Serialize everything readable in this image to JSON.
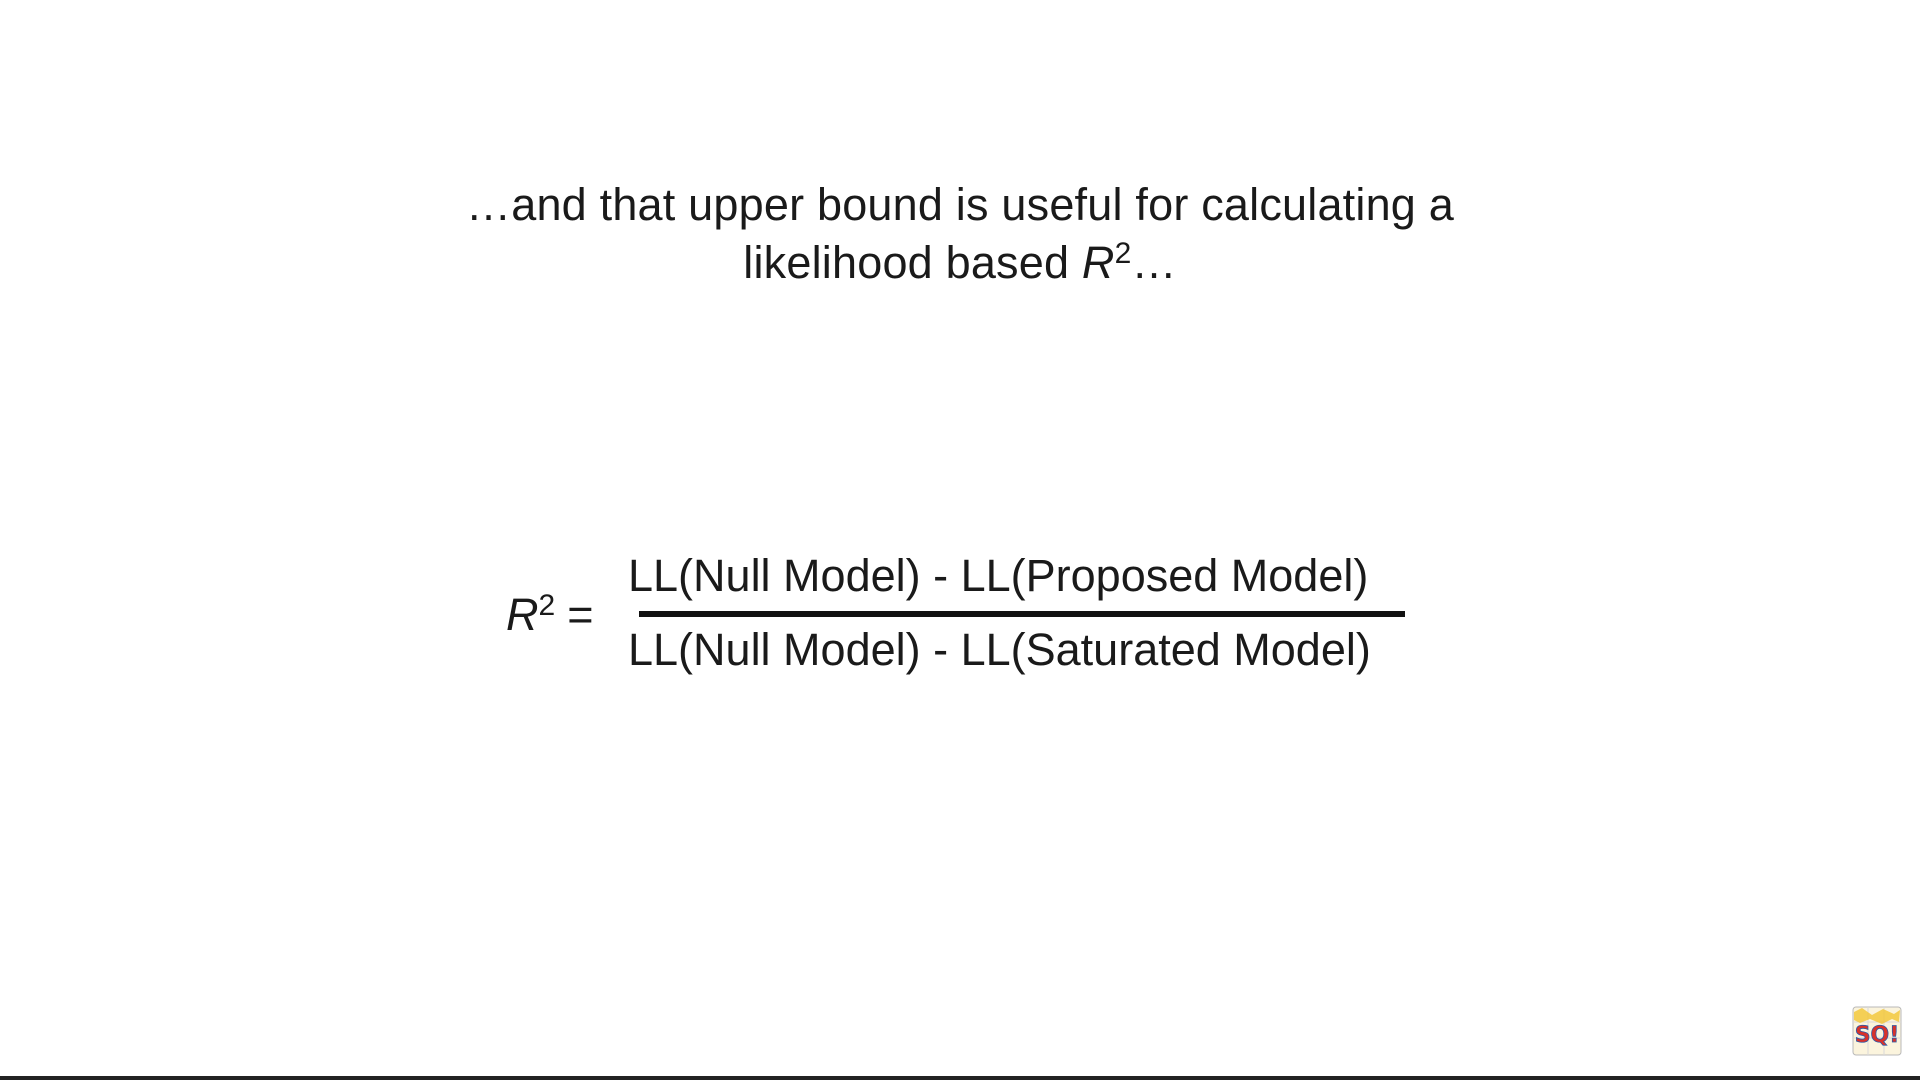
{
  "caption": {
    "line1": "…and that upper bound is useful for calculating a",
    "line2_prefix": "likelihood based ",
    "r_symbol": "R",
    "exponent": "2",
    "line2_suffix": "…"
  },
  "formula": {
    "lhs_symbol": "R",
    "lhs_exponent": "2",
    "equals": "=",
    "numerator": "LL(Null Model) - LL(Proposed Model)",
    "denominator": "LL(Null Model) - LL(Saturated Model)"
  },
  "logo": {
    "text": "SQ!",
    "icon": "channel-logo-icon",
    "colors": {
      "primary": "#d8322a",
      "secondary": "#2b5aa8",
      "highlight": "#f2c533"
    }
  }
}
